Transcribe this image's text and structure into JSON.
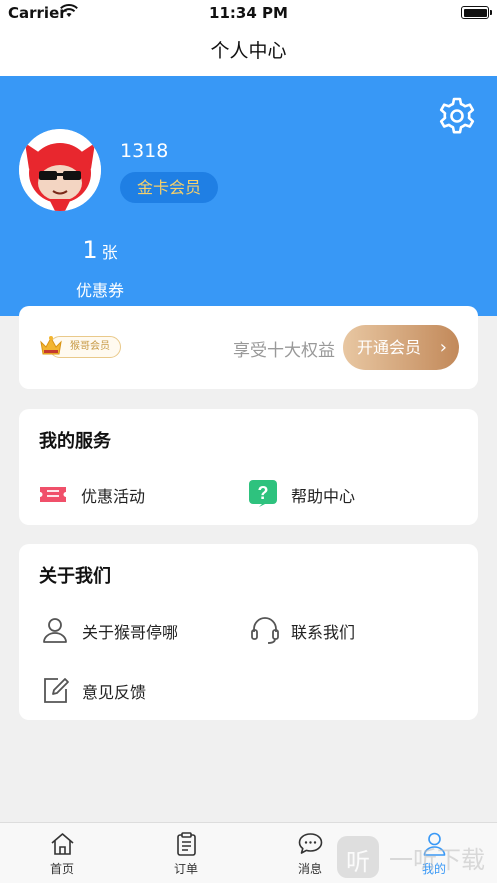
{
  "status_bar": {
    "carrier": "Carrier",
    "time": "11:34 PM"
  },
  "nav": {
    "title": "个人中心"
  },
  "profile": {
    "username": "1318",
    "member_level": "金卡会员"
  },
  "coupons": {
    "count": "1",
    "unit": "张",
    "label": "优惠券"
  },
  "vip": {
    "tag": "猴哥会员",
    "benefit": "享受十大权益",
    "button": "开通会员",
    "arrow": "›"
  },
  "services": {
    "title": "我的服务",
    "items": [
      {
        "label": "优惠活动",
        "icon": "ticket-icon"
      },
      {
        "label": "帮助中心",
        "icon": "help-icon"
      }
    ]
  },
  "about": {
    "title": "关于我们",
    "items": [
      {
        "label": "关于猴哥停哪",
        "icon": "person-icon"
      },
      {
        "label": "联系我们",
        "icon": "headset-icon"
      },
      {
        "label": "意见反馈",
        "icon": "edit-icon"
      }
    ]
  },
  "tabs": [
    {
      "label": "首页",
      "icon": "home-icon"
    },
    {
      "label": "订单",
      "icon": "order-icon"
    },
    {
      "label": "消息",
      "icon": "message-icon"
    },
    {
      "label": "我的",
      "icon": "profile-icon",
      "active": true
    }
  ],
  "watermark": {
    "text": "一听下载",
    "glyph": "听"
  },
  "colors": {
    "header_blue": "#3898f6",
    "gold": "#f5d06b",
    "ticket_red": "#f0506a",
    "help_green": "#2ec27e"
  }
}
